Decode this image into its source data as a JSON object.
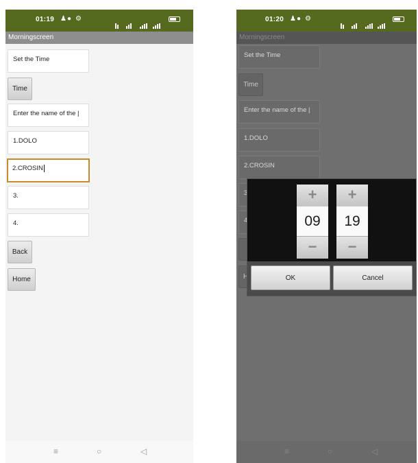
{
  "left_screen": {
    "status": {
      "time": "01:19"
    },
    "title": "Morningscreen",
    "set_time_label": "Set the Time",
    "time_button": "Time",
    "enter_name_label": "Enter the name of the |",
    "medicines": [
      "1.DOLO",
      "2.CROSIN",
      "3.",
      "4."
    ],
    "back_button": "Back",
    "home_button": "Home"
  },
  "right_screen": {
    "status": {
      "time": "01:20"
    },
    "title": "Morningscreen",
    "set_time_label": "Set the Time",
    "time_button": "Time",
    "enter_name_label": "Enter the name of the |",
    "medicines": [
      "1.DOLO",
      "2.CROSIN",
      "3",
      "4"
    ],
    "partial_b": "B",
    "partial_h": "H",
    "picker": {
      "plus": "+",
      "minus": "−",
      "hour": "09",
      "minute": "19",
      "ok_label": "OK",
      "cancel_label": "Cancel"
    }
  },
  "status_icons": {
    "notify": "♟",
    "dot1": "●",
    "dot2": "⚙"
  },
  "nav": {
    "recent": "≡",
    "home": "○",
    "back": "◁"
  },
  "colors": {
    "status_bar": "#55691f",
    "title_bar": "#8e8e8e",
    "focus_border": "#c98a2c",
    "dim_overlay": "#6f6f6f"
  }
}
